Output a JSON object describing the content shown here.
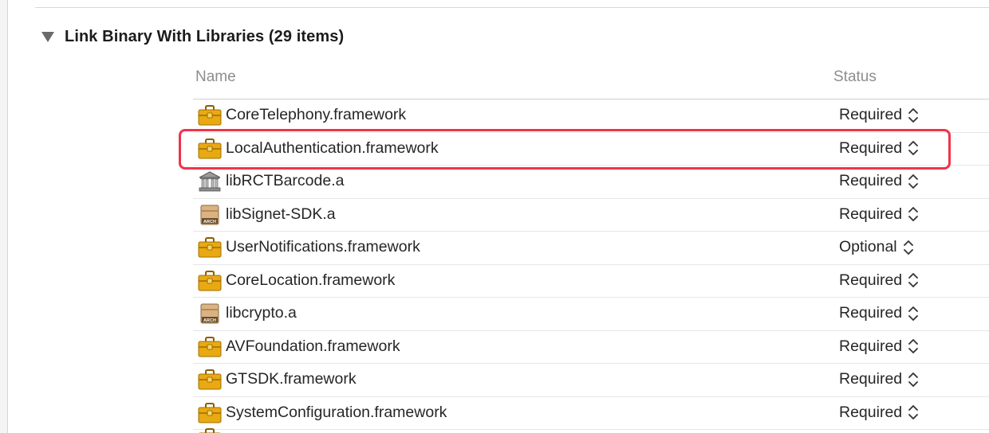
{
  "section": {
    "title": "Link Binary With Libraries (29 items)"
  },
  "table": {
    "columns": {
      "name": "Name",
      "status": "Status"
    },
    "rows": [
      {
        "name": "CoreTelephony.framework",
        "status": "Required",
        "icon": "framework-toolbox-icon"
      },
      {
        "name": "LocalAuthentication.framework",
        "status": "Required",
        "icon": "framework-toolbox-icon",
        "highlighted": true
      },
      {
        "name": "libRCTBarcode.a",
        "status": "Required",
        "icon": "library-building-icon"
      },
      {
        "name": "libSignet-SDK.a",
        "status": "Required",
        "icon": "archive-icon"
      },
      {
        "name": "UserNotifications.framework",
        "status": "Optional",
        "icon": "framework-toolbox-icon"
      },
      {
        "name": "CoreLocation.framework",
        "status": "Required",
        "icon": "framework-toolbox-icon"
      },
      {
        "name": "libcrypto.a",
        "status": "Required",
        "icon": "archive-icon"
      },
      {
        "name": "AVFoundation.framework",
        "status": "Required",
        "icon": "framework-toolbox-icon"
      },
      {
        "name": "GTSDK.framework",
        "status": "Required",
        "icon": "framework-toolbox-icon"
      },
      {
        "name": "SystemConfiguration.framework",
        "status": "Required",
        "icon": "framework-toolbox-icon"
      }
    ]
  },
  "icons": {
    "archive_label": "ARCH"
  },
  "colors": {
    "highlight": "#f0334a",
    "framework_icon": "#e8a912",
    "header_text": "#8d8d8d"
  }
}
